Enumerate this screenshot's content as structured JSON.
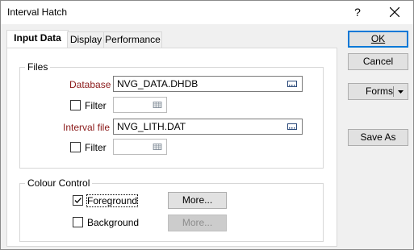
{
  "window": {
    "title": "Interval Hatch",
    "help_glyph": "?"
  },
  "tabs": [
    {
      "label": "Input Data",
      "active": true
    },
    {
      "label": "Display",
      "active": false
    },
    {
      "label": "Performance",
      "active": false
    }
  ],
  "files": {
    "group_label": "Files",
    "database_label": "Database",
    "database_value": "NVG_DATA.DHDB",
    "filter1_label": "Filter",
    "filter1_checked": false,
    "filter1_value": "",
    "interval_label": "Interval file",
    "interval_value": "NVG_LITH.DAT",
    "filter2_label": "Filter",
    "filter2_checked": false,
    "filter2_value": ""
  },
  "colour_control": {
    "group_label": "Colour Control",
    "foreground_label": "Foreground",
    "foreground_checked": true,
    "background_label": "Background",
    "background_checked": false,
    "more_label": "More...",
    "more_disabled_label": "More..."
  },
  "buttons": {
    "ok": "OK",
    "cancel": "Cancel",
    "forms": "Forms",
    "save_as": "Save As"
  },
  "colors": {
    "accent": "#0078d7",
    "field_label_red": "#8b1a1a"
  }
}
